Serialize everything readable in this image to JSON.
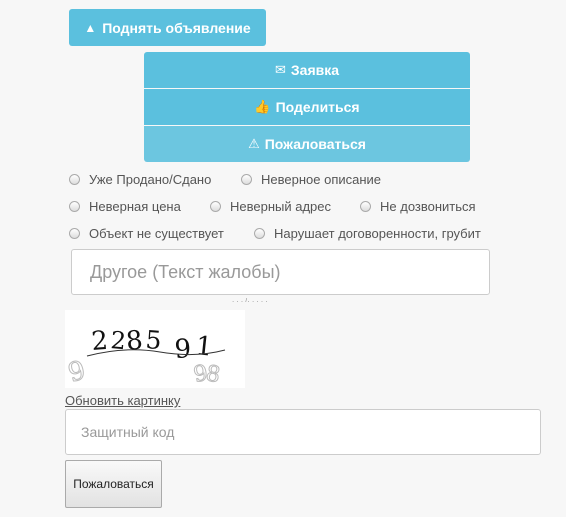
{
  "actions": {
    "raise_label": "Поднять объявление",
    "request_label": "Заявка",
    "share_label": "Поделиться",
    "complain_label": "Пожаловаться"
  },
  "reasons": [
    "Уже Продано/Сдано",
    "Неверное описание",
    "Неверная цена",
    "Неверный адрес",
    "Не дозвониться",
    "Объект не существует",
    "Нарушает договоренности, грубит"
  ],
  "complaint": {
    "placeholder": "Другое (Текст жалобы)"
  },
  "captcha": {
    "text": "2285 91",
    "noise": "9 98"
  },
  "refresh_label": "Обновить картинку",
  "security_code": {
    "placeholder": "Защитный код"
  },
  "submit_label": "Пожаловаться",
  "colors": {
    "accent": "#5bc0de",
    "background": "#f7f7f7"
  },
  "icons": {
    "raise": "chevron-up-icon",
    "request": "envelope-icon",
    "share": "thumbs-up-icon",
    "complain": "warning-icon"
  }
}
